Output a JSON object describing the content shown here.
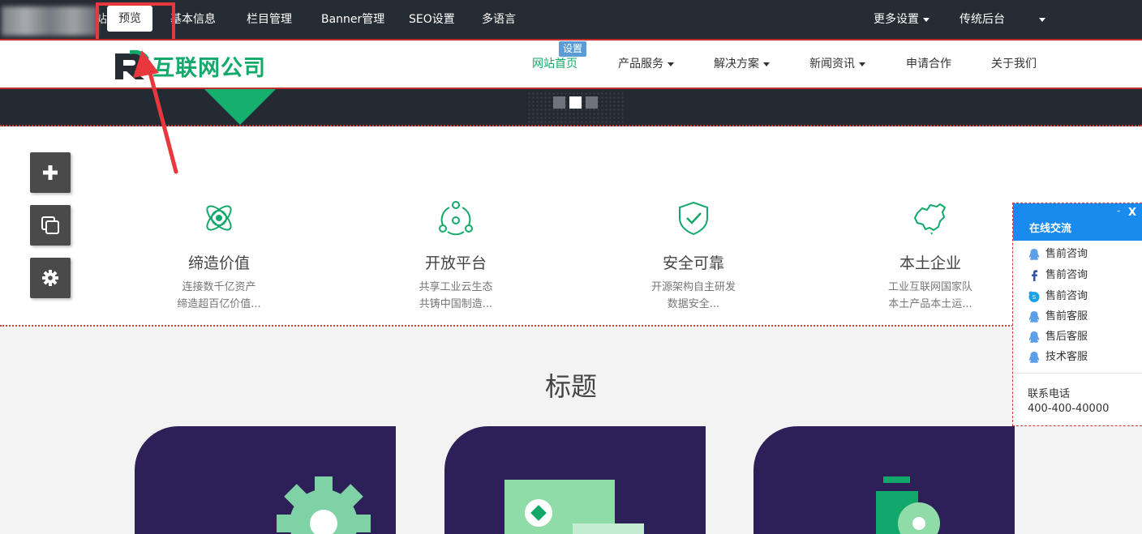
{
  "admin_bar": {
    "preview_label": "预览",
    "partial_char": "站",
    "items": [
      "基本信息",
      "栏目管理",
      "Banner管理",
      "SEO设置",
      "多语言"
    ],
    "more_settings": "更多设置",
    "classic_backend": "传统后台"
  },
  "site_header": {
    "logo_text": "互联网公司",
    "settings_tag": "设置",
    "nav": [
      "网站首页",
      "产品服务",
      "解决方案",
      "新闻资讯",
      "申请合作",
      "关于我们"
    ]
  },
  "features": [
    {
      "icon": "atom-icon",
      "title": "缔造价值",
      "desc1": "连接数千亿资产",
      "desc2": "缔造超百亿价值..."
    },
    {
      "icon": "network-icon",
      "title": "开放平台",
      "desc1": "共享工业云生态",
      "desc2": "共铸中国制造..."
    },
    {
      "icon": "shield-check-icon",
      "title": "安全可靠",
      "desc1": "开源架构自主研发",
      "desc2": "数据安全..."
    },
    {
      "icon": "china-map-icon",
      "title": "本土企业",
      "desc1": "工业互联网国家队",
      "desc2": "本土产品本土运..."
    }
  ],
  "section": {
    "title": "标题"
  },
  "chat": {
    "title": "在线交流",
    "minimize": "-",
    "close": "X",
    "items": [
      {
        "icon": "qq-icon",
        "label": "售前咨询"
      },
      {
        "icon": "facebook-icon",
        "label": "售前咨询"
      },
      {
        "icon": "skype-icon",
        "label": "售前咨询"
      },
      {
        "icon": "qq-icon",
        "label": "售前客服"
      },
      {
        "icon": "qq-icon",
        "label": "售后客服"
      },
      {
        "icon": "qq-icon",
        "label": "技术客服"
      }
    ],
    "contact_label": "联系电话",
    "contact_phone": "400-400-40000"
  },
  "colors": {
    "brand_green": "#14a96a",
    "admin_bg": "#262c33",
    "card_purple": "#2d1f58",
    "chat_blue": "#1a8bee",
    "highlight_red": "#e8383d"
  }
}
